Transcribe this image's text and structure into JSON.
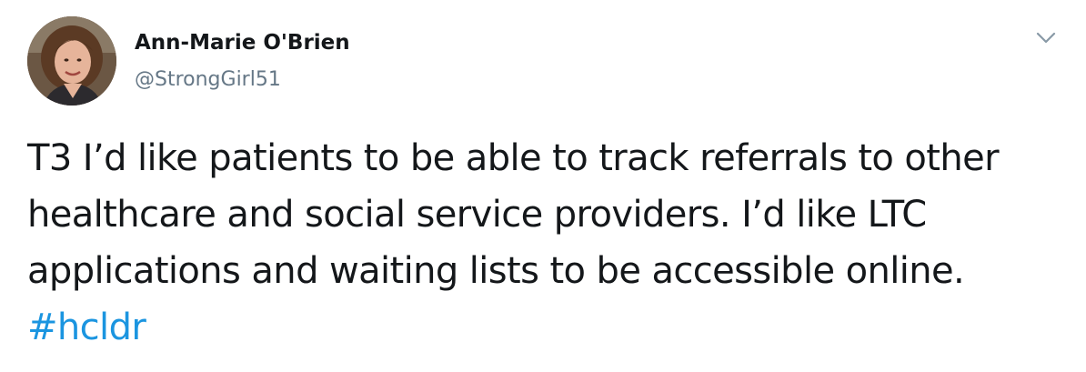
{
  "tweet": {
    "author": {
      "name": "Ann-Marie O'Brien",
      "handle": "@StrongGirl51"
    },
    "menu_icon": "chevron-down-icon",
    "text_lines": [
      "T3 I’d like patients to be able to track referrals to other",
      "healthcare and social service providers. I’d like LTC",
      "applications and waiting lists to be accessible online."
    ],
    "hashtag": "#hcldr"
  },
  "colors": {
    "text": "#14171a",
    "secondary": "#657786",
    "link": "#1b95e0",
    "background": "#ffffff"
  }
}
